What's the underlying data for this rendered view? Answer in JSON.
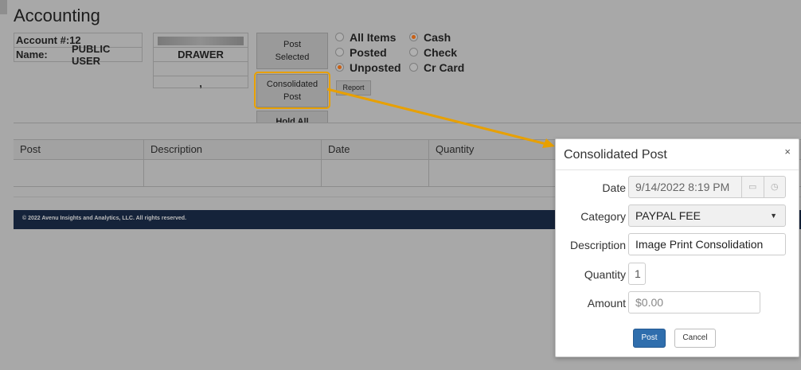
{
  "page": {
    "title": "Accounting"
  },
  "account": {
    "number_label": "Account #:",
    "number_value": "12",
    "name_label": "Name:",
    "name_value": "PUBLIC USER"
  },
  "drawer": {
    "label": "DRAWER",
    "line4": ","
  },
  "actions": {
    "post_selected_line1": "Post",
    "post_selected_line2": "Selected",
    "consolidated_line1": "Consolidated",
    "consolidated_line2": "Post",
    "hold_all": "Hold All",
    "report": "Report"
  },
  "filters": {
    "status": [
      {
        "label": "All Items",
        "selected": false
      },
      {
        "label": "Posted",
        "selected": false
      },
      {
        "label": "Unposted",
        "selected": true
      }
    ],
    "payment": [
      {
        "label": "Cash",
        "selected": true
      },
      {
        "label": "Check",
        "selected": false
      },
      {
        "label": "Cr Card",
        "selected": false
      }
    ]
  },
  "grid": {
    "columns": [
      "Post",
      "Description",
      "Date",
      "Quantity"
    ]
  },
  "footer": {
    "text": "© 2022 Avenu Insights and Analytics, LLC. All rights reserved."
  },
  "dialog": {
    "title": "Consolidated Post",
    "close": "×",
    "fields": {
      "date_label": "Date",
      "date_value": "9/14/2022 8:19 PM",
      "category_label": "Category",
      "category_value": "PAYPAL FEE",
      "description_label": "Description",
      "description_value": "Image Print Consolidation",
      "quantity_label": "Quantity",
      "quantity_value": "1",
      "amount_label": "Amount",
      "amount_placeholder": "$0.00"
    },
    "post_button": "Post",
    "cancel_button": "Cancel"
  },
  "colors": {
    "highlight": "#e8a000",
    "primary_button": "#2f6ead",
    "footer_bg": "#15233a",
    "radio_selected": "#c86015"
  }
}
